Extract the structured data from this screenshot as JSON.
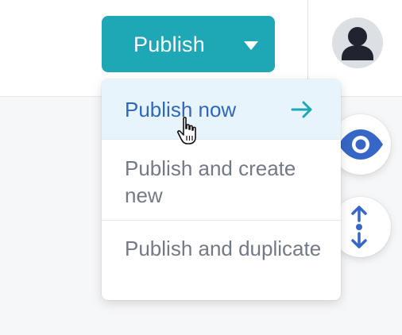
{
  "header": {
    "publish_button_label": "Publish",
    "caret_icon": "caret-down-icon",
    "avatar_icon": "user-avatar-icon"
  },
  "publish_menu": {
    "items": [
      {
        "label": "Publish now",
        "icon": "arrow-right-icon",
        "highlighted": true
      },
      {
        "label": "Publish and create new"
      },
      {
        "label": "Publish and duplicate"
      }
    ]
  },
  "side_actions": {
    "preview_icon": "eye-icon",
    "resize_icon": "resize-vertical-icon"
  },
  "cursor": "hand-pointer-icon",
  "colors": {
    "primary": "#1ea7b4",
    "menu_highlight_bg": "#e8f4fb",
    "menu_highlight_text": "#2f67bd",
    "menu_text": "#737a86",
    "icon_blue": "#3767c6",
    "avatar_bg": "#dcdfe4",
    "avatar_fg": "#1f2430"
  }
}
